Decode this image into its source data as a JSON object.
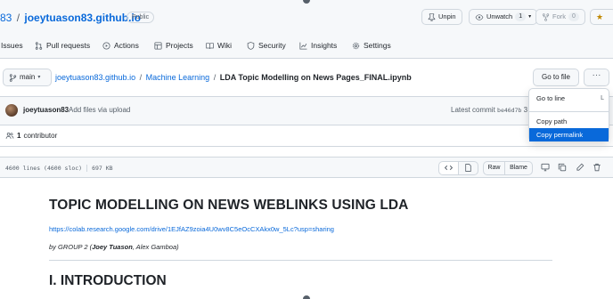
{
  "repo": {
    "owner_fragment": "83",
    "separator": "/",
    "name": "joeytuason83.github.io",
    "visibility": "Public"
  },
  "repo_actions": {
    "unpin": "Unpin",
    "unwatch": "Unwatch",
    "unwatch_count": "1",
    "fork": "Fork",
    "fork_count": "0"
  },
  "tabs": [
    {
      "label": "Issues",
      "icon": "issue-icon"
    },
    {
      "label": "Pull requests",
      "icon": "pull-request-icon"
    },
    {
      "label": "Actions",
      "icon": "play-icon"
    },
    {
      "label": "Projects",
      "icon": "table-icon"
    },
    {
      "label": "Wiki",
      "icon": "book-icon"
    },
    {
      "label": "Security",
      "icon": "shield-icon"
    },
    {
      "label": "Insights",
      "icon": "graph-icon"
    },
    {
      "label": "Settings",
      "icon": "gear-icon"
    }
  ],
  "branch": {
    "name": "main"
  },
  "breadcrumb": {
    "repo": "joeytuason83.github.io",
    "folder": "Machine Learning",
    "file": "LDA Topic Modelling on News Pages_FINAL.ipynb",
    "separator": "/"
  },
  "file_actions": {
    "go_to_file": "Go to file",
    "more": "···"
  },
  "menu": {
    "go_to_line": "Go to line",
    "go_to_line_key": "L",
    "copy_path": "Copy path",
    "copy_permalink": "Copy permalink"
  },
  "commit": {
    "user": "joeytuason83",
    "message": "Add files via upload",
    "latest_label": "Latest commit",
    "sha": "be46d7b",
    "trailing": "3"
  },
  "contributors": {
    "count": "1",
    "label": "contributor"
  },
  "file_info": {
    "lines": "4600 lines (4600 sloc)",
    "size": "697 KB"
  },
  "file_toolbar": {
    "raw": "Raw",
    "blame": "Blame"
  },
  "document": {
    "title": "TOPIC MODELLING ON NEWS WEBLINKS USING LDA",
    "link": "https://colab.research.google.com/drive/1EJfAZ9zoia4U0wv8C5eOcCXAkx0w_5Lc?usp=sharing",
    "byline_prefix": "by GROUP 2 (",
    "author_bold": "Joey Tuason",
    "byline_rest": ", Alex Gamboa)",
    "section_heading": "I. INTRODUCTION"
  },
  "colors": {
    "link": "#0969da",
    "border": "#d0d7de",
    "header_bg": "#f6f8fa",
    "menu_active": "#0969da"
  }
}
